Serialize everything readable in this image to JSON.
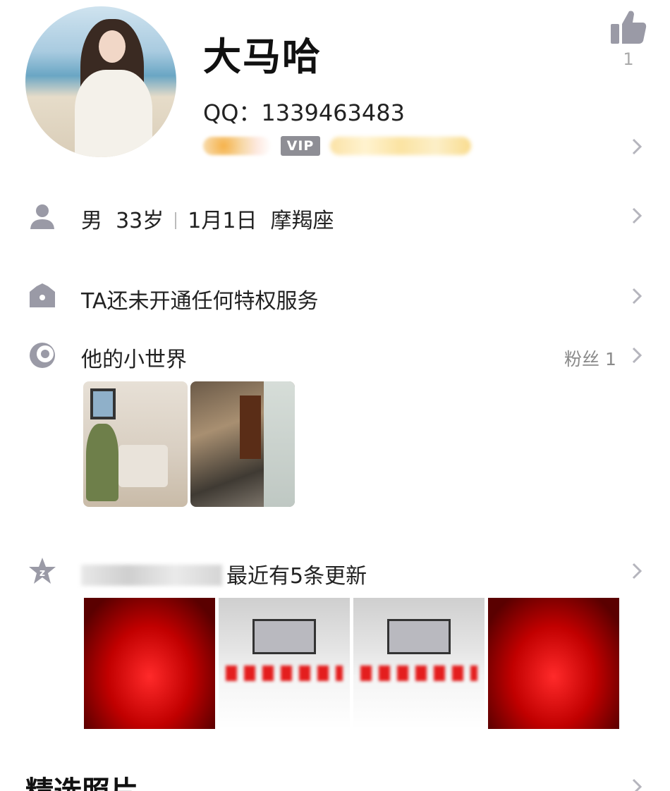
{
  "profile": {
    "name": "大马哈",
    "qq": "QQ：1339463483",
    "vip_badge": "VIP",
    "likes": "1"
  },
  "info": {
    "gender": "男",
    "age": "33岁",
    "birthday": "1月1日",
    "zodiac": "摩羯座"
  },
  "privilege": {
    "text": "TA还未开通任何特权服务"
  },
  "small_world": {
    "title": "他的小世界",
    "fans": "粉丝 1"
  },
  "space": {
    "update_text": "最近有5条更新"
  },
  "featured": {
    "title": "精选照片"
  },
  "colors": {
    "icon_gray": "#9a9aa6",
    "chevron": "#b5b5bd",
    "accent_red": "#c10000"
  },
  "icons": [
    "thumbs-up-icon",
    "person-icon",
    "crown-icon",
    "moon-icon",
    "qzone-star-icon",
    "chevron-right-icon"
  ]
}
